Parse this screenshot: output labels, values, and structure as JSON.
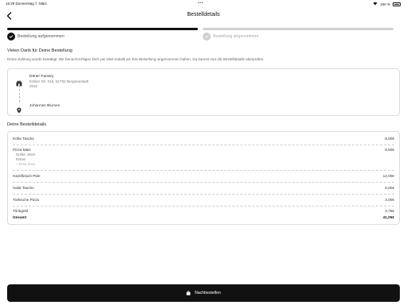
{
  "status_bar": {
    "time": "16:29",
    "date": "Donnerstag 7. März",
    "dots": "•••",
    "battery": "100 %"
  },
  "header": {
    "title": "Bestelldetails"
  },
  "steps": [
    {
      "label": "Bestellung aufgenommen",
      "state": "done"
    },
    {
      "label": "Bestellung angenommen",
      "state": "pending"
    }
  ],
  "thanks": {
    "title": "Vielen Dank für Deine Bestellung",
    "text": "Deine Zahlung wurde bestätigt. Wir benachrichtigen Dich per Mail sobald wir Ihre Bestellung angenommen haben. Du kannst nun die Bestelldetails überprüfen."
  },
  "address": {
    "shop_name": "Döner Factory",
    "shop_street": "Kölner Str. 216, 51702 Bergneustadt",
    "shop_zip": "0152",
    "customer_name": "Johannes Blumen"
  },
  "details": {
    "title": "Deine Bestelldetails",
    "items": [
      {
        "name": "Köfte Tasche",
        "price": "8,00€"
      },
      {
        "name": "Pizza Mais",
        "price": "8,50€",
        "size": "Größe: 26cm",
        "extras_label": "Extras:",
        "extra": "+ Extra Zusa"
      },
      {
        "name": "Hackfleisch Pide",
        "price": "12,00€"
      },
      {
        "name": "Salat Tasche",
        "price": "6,00€"
      },
      {
        "name": "Türkische Pizza",
        "price": "3,00€"
      }
    ],
    "tip": {
      "name": "Trinkgeld",
      "price": "3,75€"
    },
    "total": {
      "name": "Gesamt",
      "price": "41,25€"
    }
  },
  "reorder_button": {
    "label": "Nachbestellen"
  },
  "colors": {
    "accent": "#111111",
    "pending": "#cfcfcf",
    "border": "#dcdcdc"
  },
  "icons": {
    "back": "chevron-left-icon",
    "step_done": "check-circle-icon",
    "shop": "storefront-icon",
    "pin": "map-pin-icon",
    "bag": "shopping-bag-icon"
  }
}
